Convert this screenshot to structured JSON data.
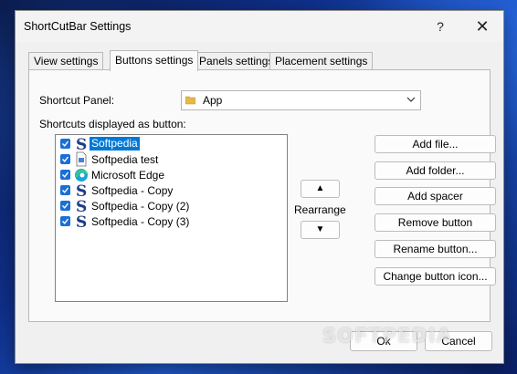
{
  "window": {
    "title": "ShortCutBar Settings",
    "help_label": "?",
    "close_label": "✕"
  },
  "tabs": [
    {
      "label": "View settings",
      "active": false
    },
    {
      "label": "Buttons settings",
      "active": true
    },
    {
      "label": "Panels settings",
      "active": false
    },
    {
      "label": "Placement settings",
      "active": false
    }
  ],
  "shortcut_panel": {
    "label": "Shortcut Panel:",
    "value": "App",
    "icon": "folder-icon"
  },
  "shortcuts": {
    "label": "Shortcuts displayed as button:",
    "items": [
      {
        "label": "Softpedia",
        "checked": true,
        "selected": true,
        "icon": "softpedia-icon"
      },
      {
        "label": "Softpedia test",
        "checked": true,
        "selected": false,
        "icon": "document-icon"
      },
      {
        "label": "Microsoft Edge",
        "checked": true,
        "selected": false,
        "icon": "edge-icon"
      },
      {
        "label": "Softpedia - Copy",
        "checked": true,
        "selected": false,
        "icon": "softpedia-icon"
      },
      {
        "label": "Softpedia - Copy (2)",
        "checked": true,
        "selected": false,
        "icon": "softpedia-icon"
      },
      {
        "label": "Softpedia - Copy (3)",
        "checked": true,
        "selected": false,
        "icon": "softpedia-icon"
      }
    ]
  },
  "rearrange": {
    "up_label": "▲",
    "label": "Rearrange",
    "down_label": "▼"
  },
  "side_buttons": {
    "add_file": "Add file...",
    "add_folder": "Add folder...",
    "add_spacer": "Add spacer",
    "remove": "Remove button",
    "rename": "Rename button...",
    "change_icon": "Change button icon..."
  },
  "footer": {
    "ok": "Ok",
    "cancel": "Cancel"
  },
  "watermark": "SOFTPEDIA",
  "colors": {
    "accent": "#0078d7",
    "checkbox": "#1a6fd6",
    "softpedia_blue": "#1f3c8a"
  }
}
